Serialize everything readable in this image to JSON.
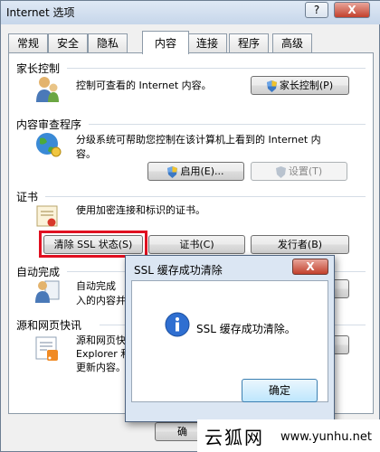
{
  "window": {
    "title": "Internet 选项",
    "help": "?",
    "close": "X"
  },
  "tabs": [
    "常规",
    "安全",
    "隐私",
    "内容",
    "连接",
    "程序",
    "高级"
  ],
  "parental": {
    "heading": "家长控制",
    "desc": "控制可查看的 Internet 内容。",
    "button": "家长控制(P)"
  },
  "advisor": {
    "heading": "内容审查程序",
    "desc1": "分级系统可帮助您控制在该计算机上看到的 Internet 内",
    "desc2": "容。",
    "enable": "启用(E)...",
    "settings": "设置(T)"
  },
  "certs": {
    "heading": "证书",
    "desc": "使用加密连接和标识的证书。",
    "clear_ssl": "清除 SSL 状态(S)",
    "certificates": "证书(C)",
    "publishers": "发行者(B)"
  },
  "autocomplete": {
    "heading": "自动完成",
    "desc1": "自动完成",
    "desc2": "入的内容并"
  },
  "feeds": {
    "heading": "源和网页快讯",
    "desc1": "源和网页快讯",
    "desc2": "Explorer 和",
    "desc3": "更新内容。"
  },
  "footer": {
    "ok_partial": "确"
  },
  "dialog": {
    "title": "SSL 缓存成功清除",
    "close": "X",
    "message": "SSL 缓存成功清除。",
    "ok": "确定"
  },
  "watermark": {
    "brand": "云狐网",
    "url": "www.yunhu.net"
  }
}
